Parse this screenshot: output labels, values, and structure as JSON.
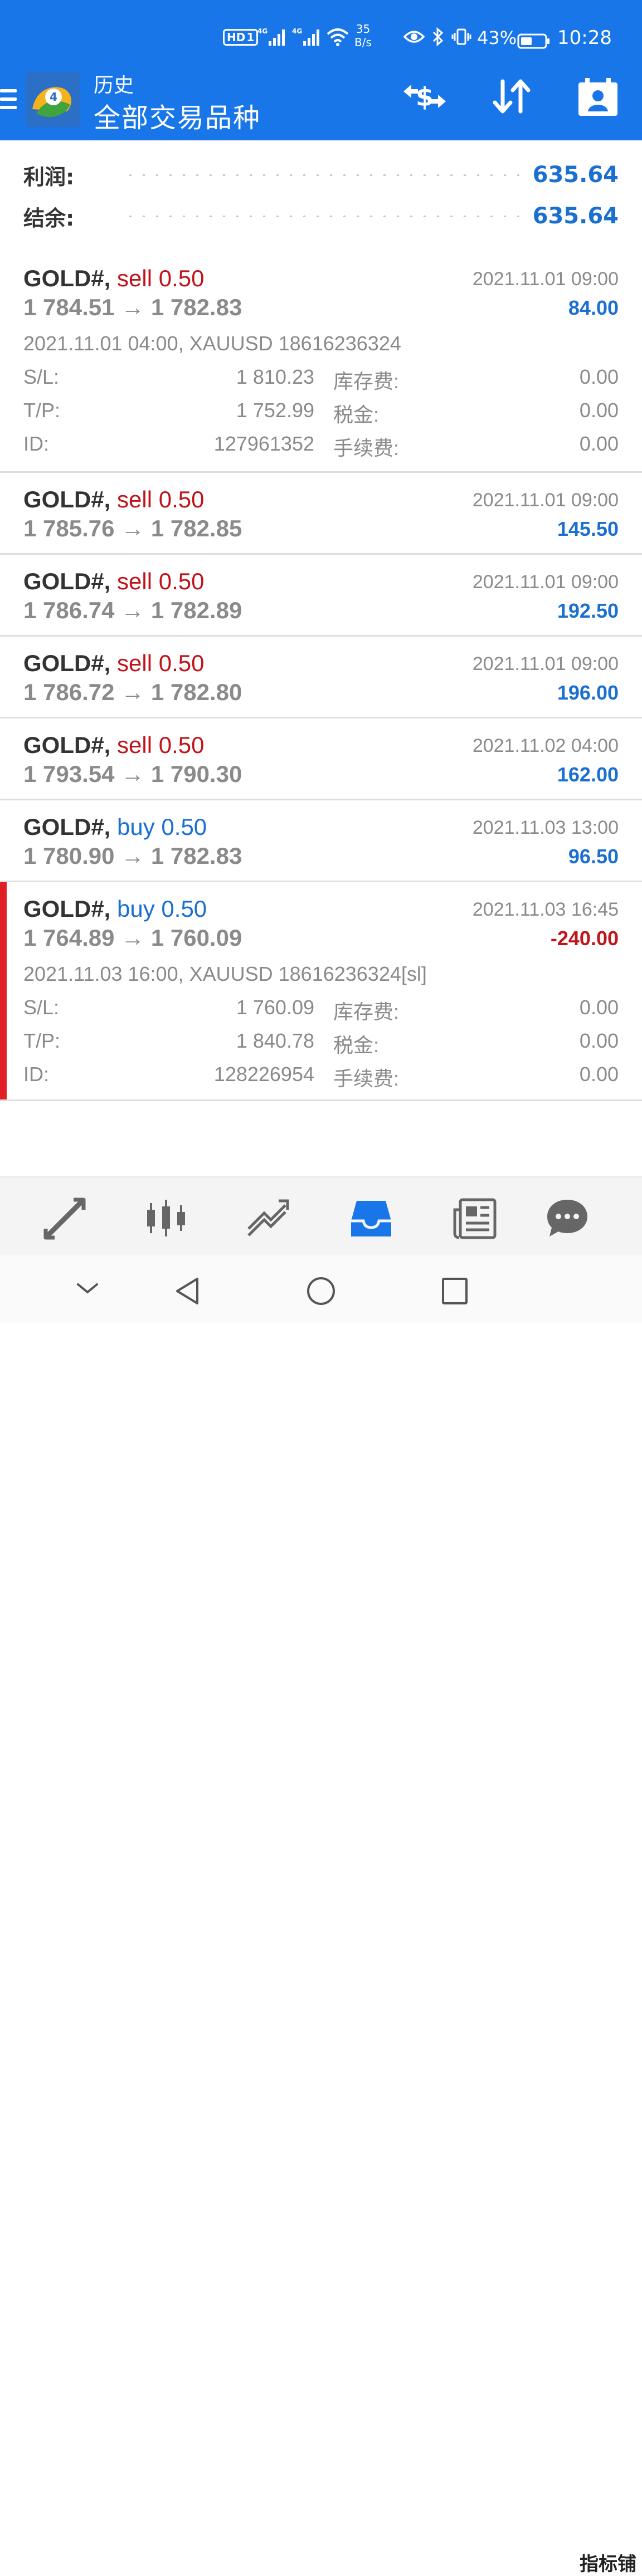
{
  "status_bar": {
    "hd_label": "HD",
    "hd_slot": "1",
    "network_1": "4G",
    "network_2": "4G",
    "speed_value": "35",
    "speed_unit": "B/s",
    "battery_percent": "43%",
    "time": "10:28"
  },
  "app_bar": {
    "subtitle": "历史",
    "title": "全部交易品种",
    "icons": [
      "menu-icon",
      "currency-exchange-icon",
      "sort-icon",
      "account-icon"
    ]
  },
  "summary": {
    "profit_label": "利润:",
    "profit_value": "635.64",
    "balance_label": "结余:",
    "balance_value": "635.64"
  },
  "deals": [
    {
      "symbol": "GOLD#,",
      "action": "sell 0.50",
      "prices": "1 784.51 → 1 782.83",
      "time": "2021.11.01 09:00",
      "profit": "84.00",
      "detail": "2021.11.01 04:00, XAUUSD 18616236324",
      "sl_label": "S/L:",
      "sl_value": "1 810.23",
      "tp_label": "T/P:",
      "tp_value": "1 752.99",
      "id_label": "ID:",
      "id_value": "127961352",
      "swap_label": "库存费:",
      "swap_value": "0.00",
      "tax_label": "税金:",
      "tax_value": "0.00",
      "fee_label": "手续费:",
      "fee_value": "0.00"
    },
    {
      "symbol": "GOLD#,",
      "action": "sell 0.50",
      "prices": "1 785.76 → 1 782.85",
      "time": "2021.11.01 09:00",
      "profit": "145.50"
    },
    {
      "symbol": "GOLD#,",
      "action": "sell 0.50",
      "prices": "1 786.74 → 1 782.89",
      "time": "2021.11.01 09:00",
      "profit": "192.50"
    },
    {
      "symbol": "GOLD#,",
      "action": "sell 0.50",
      "prices": "1 786.72 → 1 782.80",
      "time": "2021.11.01 09:00",
      "profit": "196.00"
    },
    {
      "symbol": "GOLD#,",
      "action": "sell 0.50",
      "prices": "1 793.54 → 1 790.30",
      "time": "2021.11.02 04:00",
      "profit": "162.00"
    },
    {
      "symbol": "GOLD#,",
      "action": "buy 0.50",
      "prices": "1 780.90 → 1 782.83",
      "time": "2021.11.03 13:00",
      "profit": "96.50"
    },
    {
      "symbol": "GOLD#,",
      "action": "buy 0.50",
      "prices": "1 764.89 → 1 760.09",
      "time": "2021.11.03 16:45",
      "profit": "-240.00",
      "detail": "2021.11.03 16:00, XAUUSD 18616236324[sl]",
      "sl_label": "S/L:",
      "sl_value": "1 760.09",
      "tp_label": "T/P:",
      "tp_value": "1 840.78",
      "id_label": "ID:",
      "id_value": "128226954",
      "swap_label": "库存费:",
      "swap_value": "0.00",
      "tax_label": "税金:",
      "tax_value": "0.00",
      "fee_label": "手续费:",
      "fee_value": "0.00"
    }
  ],
  "bottom_nav": {
    "items": [
      "quotes-icon",
      "chart-icon",
      "trade-icon",
      "history-icon",
      "news-icon",
      "messages-icon"
    ],
    "active": "history-icon"
  },
  "system_nav": [
    "collapse-icon",
    "back-icon",
    "home-icon",
    "recents-icon"
  ],
  "watermark": "指标铺",
  "colors": {
    "app_bar": "#1976e8",
    "profit_positive": "#1a6fd1",
    "profit_negative": "#c0141b",
    "sell": "#c0141b",
    "buy": "#1a6fd1",
    "selected_marker": "#e01e26"
  }
}
